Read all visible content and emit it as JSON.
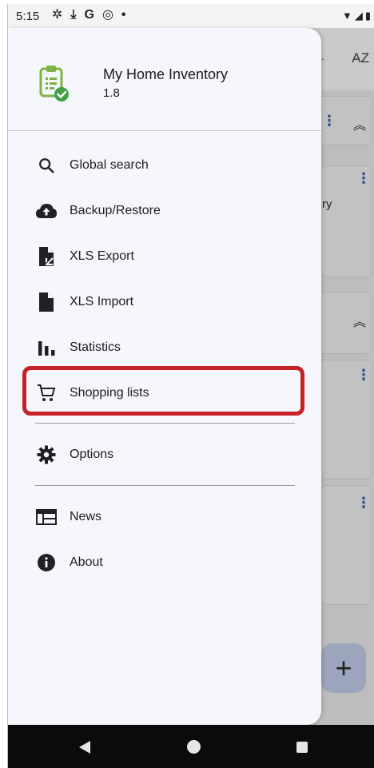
{
  "status_bar": {
    "time": "5:15",
    "icons": [
      "gear-icon",
      "download-icon",
      "google-icon",
      "vpn-icon",
      "dot-icon"
    ],
    "right_icons": [
      "wifi-icon",
      "signal-icon",
      "battery-icon"
    ]
  },
  "background_app": {
    "sort_label": "AZ",
    "card_text": "ry"
  },
  "drawer": {
    "app_name": "My Home Inventory",
    "app_version": "1.8",
    "items": [
      {
        "label": "Global search",
        "icon": "search-icon"
      },
      {
        "label": "Backup/Restore",
        "icon": "cloud-upload-icon"
      },
      {
        "label": "XLS Export",
        "icon": "file-export-icon"
      },
      {
        "label": "XLS Import",
        "icon": "file-icon"
      },
      {
        "label": "Statistics",
        "icon": "bar-chart-icon"
      },
      {
        "label": "Shopping lists",
        "icon": "shopping-cart-icon"
      },
      {
        "label": "Options",
        "icon": "gear-icon"
      },
      {
        "label": "News",
        "icon": "news-icon"
      },
      {
        "label": "About",
        "icon": "info-icon"
      }
    ]
  },
  "colors": {
    "highlight": "#c52126",
    "logo_green": "#7cb342",
    "check_green": "#43a047"
  }
}
